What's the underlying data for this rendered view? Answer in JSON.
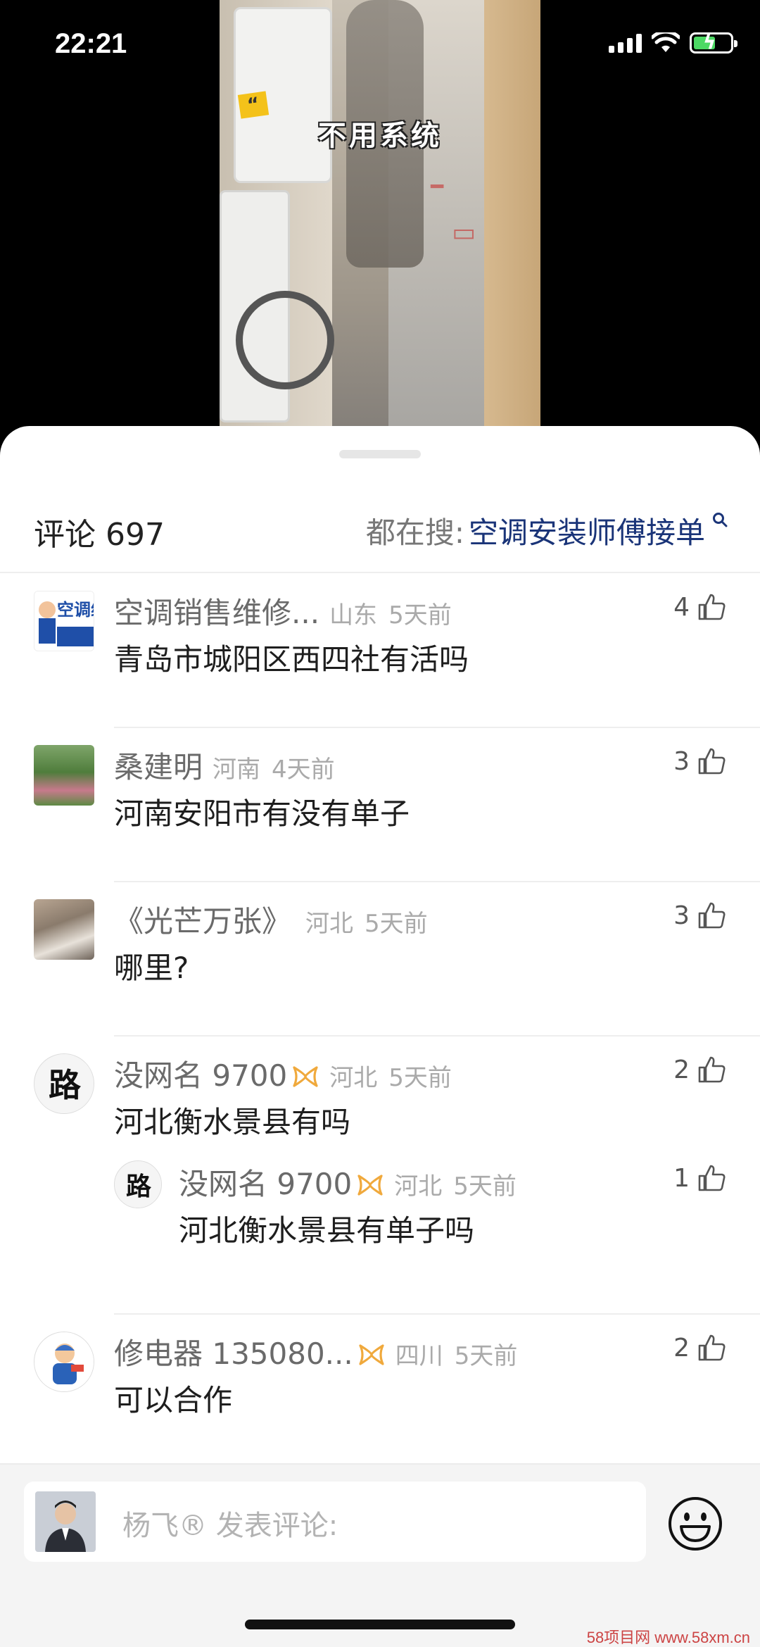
{
  "status_bar": {
    "time": "22:21"
  },
  "video": {
    "caption": "不用系统"
  },
  "sheet": {
    "comment_count_label": "评论 697",
    "search_prefix": "都在搜:",
    "search_term": "空调安装师傅接单"
  },
  "comments": [
    {
      "name": "空调销售维修...",
      "location": "山东",
      "time": "5天前",
      "text": "青岛市城阳区西四社有活吗",
      "likes": "4",
      "avatar_text": "空调维修"
    },
    {
      "name": "桑建明",
      "location": "河南",
      "time": "4天前",
      "text": "河南安阳市有没有单子",
      "likes": "3"
    },
    {
      "name": "《光芒万张》",
      "location": "河北",
      "time": "5天前",
      "text": "哪里?",
      "likes": "3"
    },
    {
      "name": "没网名 9700",
      "location": "河北",
      "time": "5天前",
      "text": "河北衡水景县有吗",
      "likes": "2",
      "avatar_text": "路"
    },
    {
      "name": "没网名 9700",
      "location": "河北",
      "time": "5天前",
      "text": "河北衡水景县有单子吗",
      "likes": "1",
      "avatar_text": "路"
    },
    {
      "name": "修电器 135080...",
      "location": "四川",
      "time": "5天前",
      "text": "可以合作",
      "likes": "2"
    }
  ],
  "input_bar": {
    "placeholder": "杨飞® 发表评论:"
  },
  "watermark": "58项目网 www.58xm.cn",
  "colors": {
    "search_term": "#1a3478",
    "badge": "#f0a93c",
    "battery": "#4cd964"
  },
  "icons": [
    "search-icon",
    "like-icon",
    "vip-badge-icon",
    "emoji-icon",
    "wifi-icon",
    "battery-icon",
    "signal-icon"
  ]
}
